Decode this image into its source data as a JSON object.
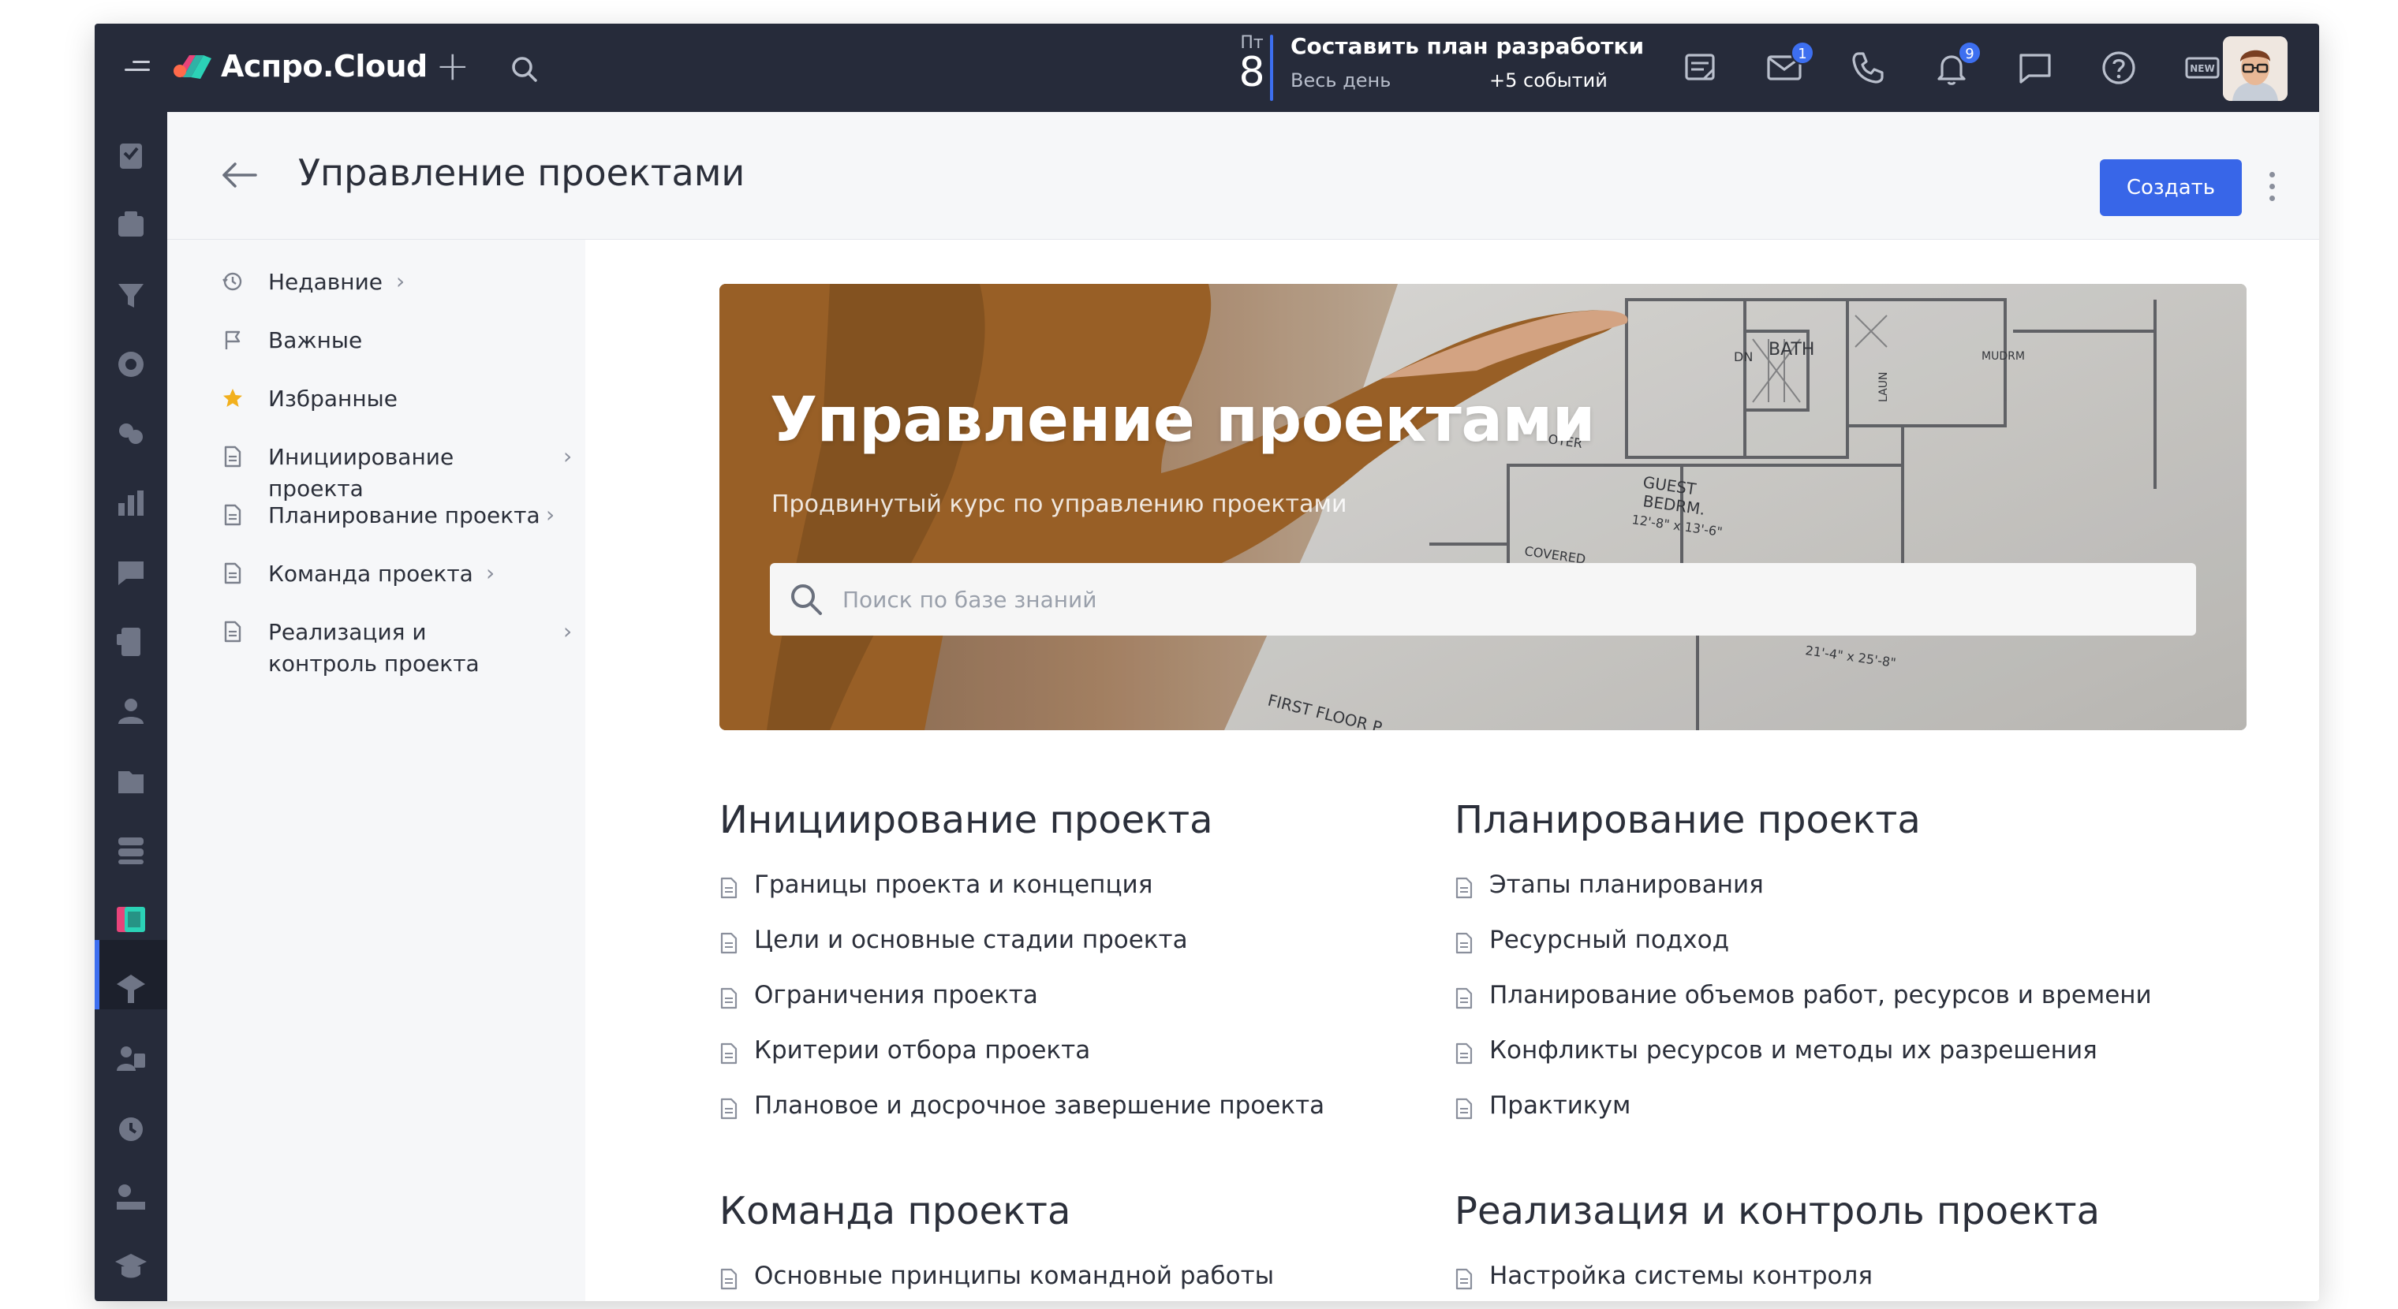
{
  "topbar": {
    "brand": "Аспро.Cloud",
    "event": {
      "day_of_week": "Пт",
      "day": "8",
      "title": "Составить план разработки",
      "subtitle": "Весь день",
      "more": "+5 событий"
    },
    "icons": [
      {
        "name": "notes-icon"
      },
      {
        "name": "mail-icon",
        "badge": "1"
      },
      {
        "name": "phone-icon"
      },
      {
        "name": "bell-icon",
        "badge": "9"
      },
      {
        "name": "chat-icon"
      },
      {
        "name": "help-icon"
      },
      {
        "name": "new-icon",
        "text": "NEW"
      }
    ]
  },
  "page": {
    "title": "Управление проектами",
    "create_label": "Создать"
  },
  "kb_sidebar": {
    "items": [
      {
        "label": "Недавние",
        "icon": "history-icon",
        "chevron": true
      },
      {
        "label": "Важные",
        "icon": "flag-icon",
        "chevron": false
      },
      {
        "label": "Избранные",
        "icon": "star-icon",
        "chevron": false
      },
      {
        "label": "Инициирование проекта",
        "icon": "document-icon",
        "chevron": true
      },
      {
        "label": "Планирование проекта",
        "icon": "document-icon",
        "chevron": true
      },
      {
        "label": "Команда проекта",
        "icon": "document-icon",
        "chevron": true
      },
      {
        "label": "Реализация и контроль проекта",
        "icon": "document-icon",
        "chevron": true
      }
    ]
  },
  "hero": {
    "title": "Управление проектами",
    "subtitle": "Продвинутый курс по управлению проектами",
    "search_placeholder": "Поиск по базе знаний",
    "blueprint_labels": [
      "BATH",
      "DN",
      "LAUN",
      "MUDRM",
      "GUEST",
      "BEDRM.",
      "12'-8\" x 13'-6\"",
      "COVERED",
      "FIRST FLOOR P",
      "21'-4\" x 25'-8\"",
      "OTER"
    ]
  },
  "sections": [
    {
      "title": "Инициирование проекта",
      "links": [
        "Границы проекта и концепция",
        "Цели и основные стадии проекта",
        "Ограничения проекта",
        "Критерии отбора проекта",
        "Плановое и досрочное завершение проекта"
      ]
    },
    {
      "title": "Планирование проекта",
      "links": [
        "Этапы планирования",
        "Ресурсный подход",
        "Планирование объемов работ, ресурсов и времени",
        "Конфликты ресурсов и методы их разрешения",
        "Практикум"
      ]
    },
    {
      "title": "Команда проекта",
      "links": [
        "Основные принципы командной работы"
      ]
    },
    {
      "title": "Реализация и контроль проекта",
      "links": [
        "Настройка системы контроля"
      ]
    }
  ],
  "colors": {
    "dark": "#262b3a",
    "accent": "#3866e8",
    "page_bg": "#f6f7f9",
    "star": "#f2b01e"
  }
}
